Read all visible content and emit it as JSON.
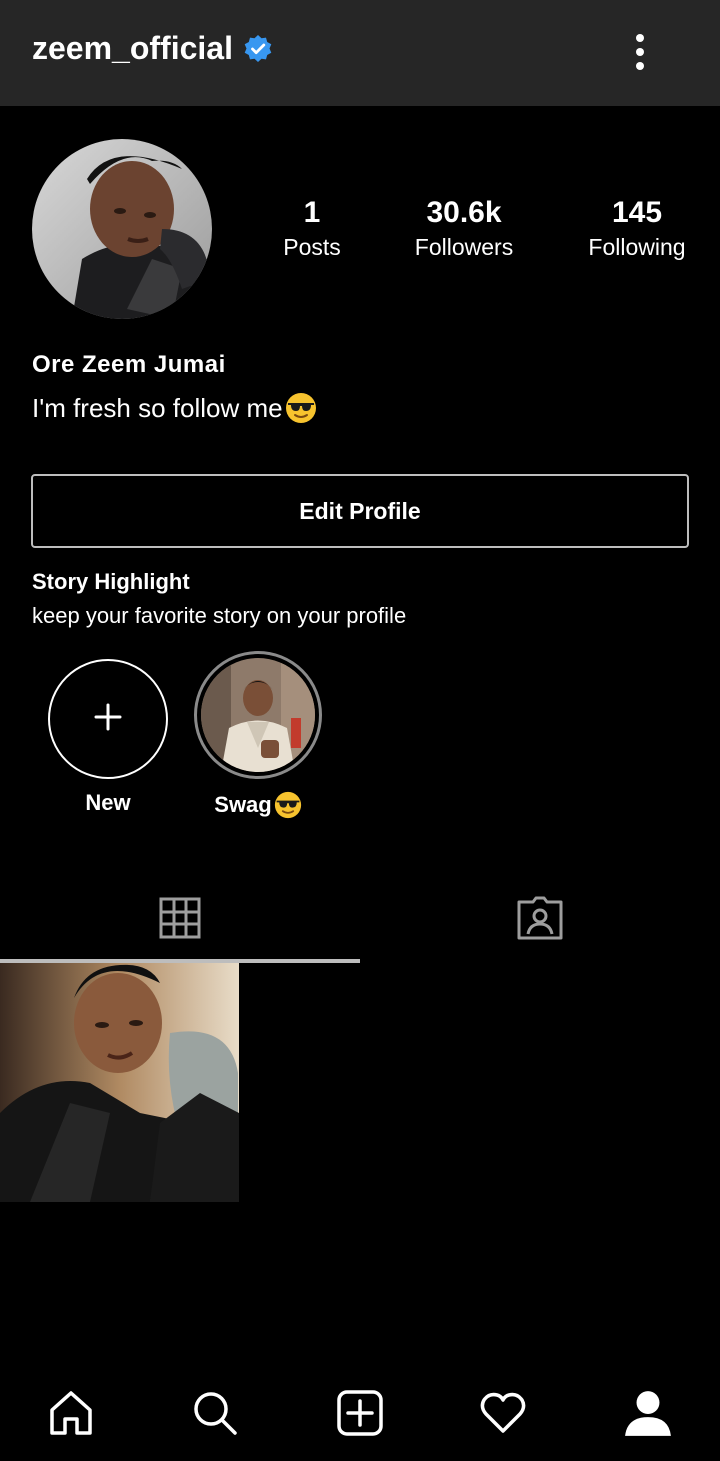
{
  "header": {
    "username": "zeem_official",
    "verified_icon": "verified-badge-icon",
    "menu_icon": "more-vertical-icon"
  },
  "profile": {
    "stats": [
      {
        "value": "1",
        "label": "Posts"
      },
      {
        "value": "30.6k",
        "label": "Followers"
      },
      {
        "value": "145",
        "label": "Following"
      }
    ],
    "full_name": "Ore Zeem Jumai",
    "bio": "I'm fresh so follow me",
    "bio_emoji": "sunglasses-emoji",
    "edit_button": "Edit Profile"
  },
  "highlights": {
    "title": "Story Highlight",
    "subtitle": "keep your favorite story on your profile",
    "items": [
      {
        "label": "New",
        "icon": "plus-icon"
      },
      {
        "label": "Swag",
        "emoji": "sunglasses-emoji"
      }
    ]
  },
  "tabs": [
    {
      "icon": "grid-icon",
      "active": true
    },
    {
      "icon": "tagged-icon",
      "active": false
    }
  ],
  "nav": [
    {
      "icon": "home-icon"
    },
    {
      "icon": "search-icon"
    },
    {
      "icon": "add-post-icon"
    },
    {
      "icon": "heart-icon"
    },
    {
      "icon": "profile-icon"
    }
  ],
  "colors": {
    "topbar": "#262626",
    "background": "#000000",
    "verified": "#3897f0"
  }
}
